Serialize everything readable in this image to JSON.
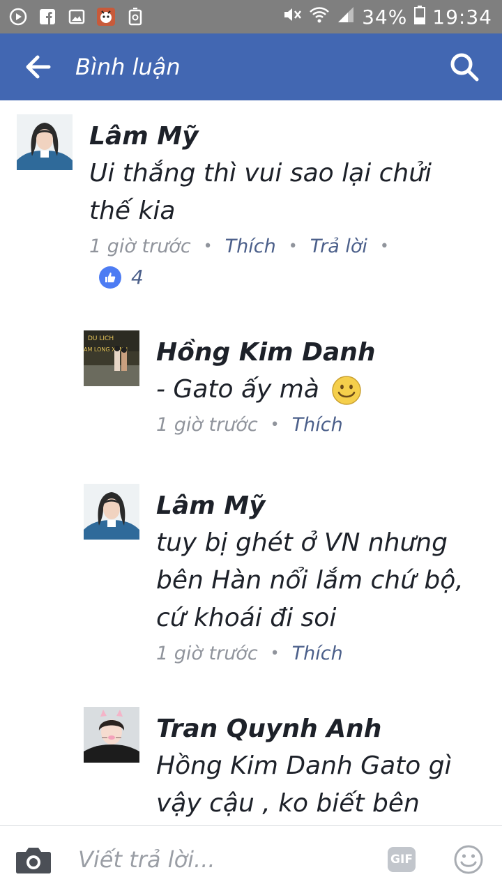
{
  "status_bar": {
    "battery": "34%",
    "time": "19:34",
    "left_icons": [
      "media-icon",
      "facebook-icon",
      "image-icon",
      "game-icon",
      "recycle-icon"
    ],
    "right_icons": [
      "mute-icon",
      "wifi-icon",
      "signal-icon",
      "battery-icon"
    ]
  },
  "header": {
    "title": "Bình luận"
  },
  "comments": [
    {
      "author": "Lâm Mỹ",
      "text": "Ui thắng thì vui sao lại chửi thế kia",
      "time": "1 giờ trước",
      "like_label": "Thích",
      "reply_label": "Trả lời",
      "like_count": "4"
    },
    {
      "author": "Hồng Kim Danh",
      "text": "- Gato ấy mà",
      "time": "1 giờ trước",
      "like_label": "Thích"
    },
    {
      "author": "Lâm Mỹ",
      "text": "tuy bị ghét ở VN nhưng bên Hàn nổi lắm chứ bộ, cứ khoái đi soi",
      "time": "1 giờ trước",
      "like_label": "Thích"
    },
    {
      "author": "Tran Quynh Anh",
      "text": "Hồng Kim Danh Gato gì vậy cậu , ko biết bên"
    }
  ],
  "compose": {
    "placeholder": "Viết trả lời...",
    "gif_label": "GIF"
  },
  "colors": {
    "header_bg": "#4267b2",
    "status_bar_bg": "#7f7f7f",
    "action_link": "#4b5f8a",
    "meta_gray": "#90949c",
    "like_blue": "#4d7cf3"
  }
}
